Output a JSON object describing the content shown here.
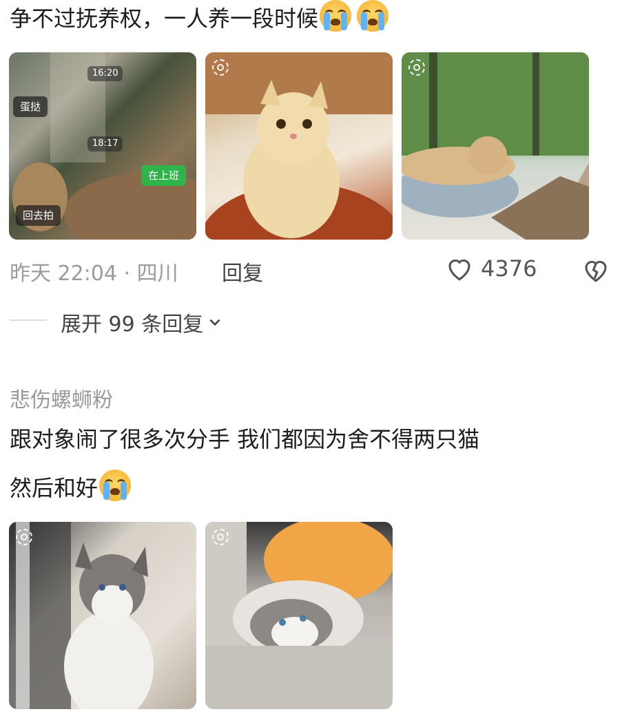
{
  "comment1": {
    "text": "争不过抚养权，一人养一段时候",
    "images": [
      {
        "chips": {
          "t1": "16:20",
          "c1": "蛋挞",
          "t2": "18:17",
          "c2": "在上班",
          "c3": "回去拍"
        }
      },
      {},
      {}
    ],
    "meta": "昨天 22:04 · 四川",
    "reply_label": "回复",
    "like_count": "4376",
    "expand_label": "展开 99 条回复"
  },
  "comment2": {
    "username": "悲伤螺蛳粉",
    "text_line1": "跟对象闹了很多次分手 我们都因为舍不得两只猫",
    "text_line2": "然后和好"
  },
  "icons": {
    "emoji": "crying-face-emoji",
    "like": "heart-outline-icon",
    "dislike": "broken-heart-icon",
    "expand": "chevron-down-icon",
    "live": "live-photo-icon"
  }
}
